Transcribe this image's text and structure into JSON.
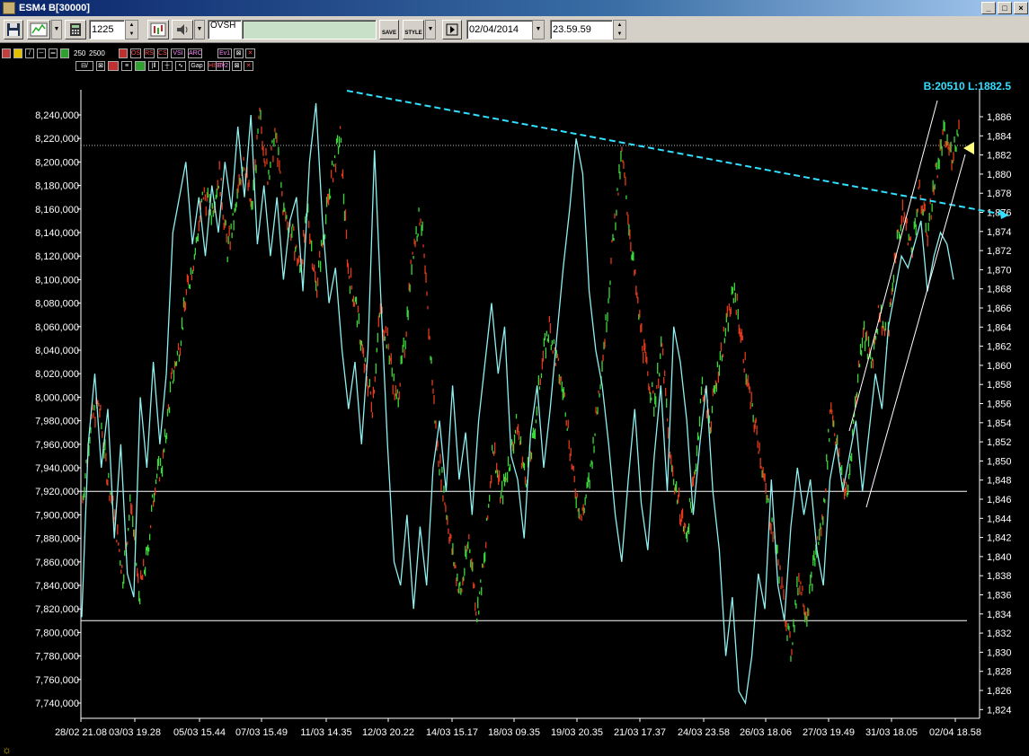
{
  "window": {
    "title": "ESM4 B[30000]",
    "controls": [
      "_",
      "□",
      "×"
    ]
  },
  "toolbar": {
    "interval_value": "1225",
    "symbol_value": "OVSH",
    "save_label": "SAVE",
    "style_label": "STYLE",
    "date_value": "02/04/2014",
    "time_value": "23.59.59"
  },
  "chart_toolbar": {
    "val_250": "250",
    "val_2500": "2500",
    "icons": [
      "OS",
      "RS",
      "CS",
      "VSI",
      "ARC",
      "Ev1",
      "Ev2",
      "HIST",
      "Gap"
    ]
  },
  "chart_header": "B:20510 L:1882.5",
  "colors": {
    "cyan_line": "#8ff0f0",
    "bull": "#3ad83a",
    "bear": "#e03a1a",
    "trend": "#33e0ff",
    "marker": "#ffff80"
  },
  "chart_data": {
    "type": "line",
    "left_axis": {
      "ticks": [
        "8,240,000",
        "8,220,000",
        "8,200,000",
        "8,180,000",
        "8,160,000",
        "8,140,000",
        "8,120,000",
        "8,100,000",
        "8,080,000",
        "8,060,000",
        "8,040,000",
        "8,020,000",
        "8,000,000",
        "7,980,000",
        "7,960,000",
        "7,940,000",
        "7,920,000",
        "7,900,000",
        "7,880,000",
        "7,860,000",
        "7,840,000",
        "7,820,000",
        "7,800,000",
        "7,780,000",
        "7,760,000",
        "7,740,000"
      ],
      "range": [
        7730000,
        8250000
      ]
    },
    "right_axis": {
      "ticks": [
        "1,886",
        "1,884",
        "1,882",
        "1,880",
        "1,878",
        "1,876",
        "1,874",
        "1,872",
        "1,870",
        "1,868",
        "1,866",
        "1,864",
        "1,862",
        "1,860",
        "1,858",
        "1,856",
        "1,854",
        "1,852",
        "1,850",
        "1,848",
        "1,846",
        "1,844",
        "1,842",
        "1,840",
        "1,838",
        "1,836",
        "1,834",
        "1,832",
        "1,830",
        "1,828",
        "1,826",
        "1,824"
      ],
      "range": [
        1823,
        1887
      ]
    },
    "x_ticks": [
      "28/02 21.08",
      "03/03 19.28",
      "05/03 15.44",
      "07/03 15.49",
      "11/03 14.35",
      "12/03 20.22",
      "14/03 15.17",
      "18/03 09.35",
      "19/03 20.35",
      "21/03 17.37",
      "24/03 23.58",
      "26/03 18.06",
      "27/03 19.49",
      "31/03 18.05",
      "02/04 18.58"
    ],
    "horizontal_lines_left": [
      7920000,
      7810000
    ],
    "horizontal_lines_right": [
      1883
    ],
    "breadth_series": [
      7813000,
      7960000,
      8020000,
      7940000,
      7990000,
      7880000,
      7960000,
      7850000,
      7830000,
      8000000,
      7940000,
      8030000,
      7960000,
      8020000,
      8140000,
      8170000,
      8200000,
      8130000,
      8170000,
      8120000,
      8180000,
      8140000,
      8200000,
      8160000,
      8230000,
      8170000,
      8240000,
      8130000,
      8180000,
      8120000,
      8170000,
      8100000,
      8150000,
      8170000,
      8090000,
      8200000,
      8250000,
      8150000,
      8080000,
      8110000,
      8040000,
      7990000,
      8030000,
      7960000,
      8040000,
      8210000,
      8080000,
      7960000,
      7860000,
      7840000,
      7900000,
      7820000,
      7890000,
      7840000,
      7940000,
      7980000,
      7920000,
      8010000,
      7930000,
      7970000,
      7900000,
      7980000,
      8030000,
      8080000,
      8020000,
      8060000,
      7950000,
      7930000,
      7880000,
      7970000,
      8010000,
      7940000,
      7990000,
      8050000,
      8110000,
      8160000,
      8220000,
      8190000,
      8090000,
      8040000,
      8010000,
      7960000,
      7900000,
      7860000,
      7930000,
      7990000,
      7910000,
      7870000,
      7950000,
      8010000,
      7920000,
      8060000,
      8030000,
      7980000,
      7900000,
      7960000,
      8010000,
      7920000,
      7870000,
      7780000,
      7830000,
      7750000,
      7740000,
      7780000,
      7850000,
      7820000,
      7930000,
      7840000,
      7810000,
      7890000,
      7940000,
      7900000,
      7930000,
      7870000,
      7840000,
      7930000,
      7960000,
      7920000,
      7950000,
      7980000,
      7920000,
      7970000,
      8020000,
      7990000,
      8060000,
      8090000,
      8120000,
      8110000,
      8130000,
      8150000,
      8090000,
      8120000,
      8140000,
      8130000,
      8100000
    ],
    "price_series": [
      1846,
      1854,
      1856,
      1849,
      1844,
      1838,
      1846,
      1836,
      1840,
      1848,
      1850,
      1858,
      1862,
      1868,
      1872,
      1878,
      1876,
      1880,
      1872,
      1876,
      1882,
      1876,
      1886,
      1880,
      1884,
      1876,
      1874,
      1870,
      1876,
      1868,
      1874,
      1880,
      1884,
      1870,
      1866,
      1860,
      1856,
      1866,
      1862,
      1856,
      1862,
      1872,
      1876,
      1864,
      1852,
      1846,
      1840,
      1836,
      1842,
      1834,
      1840,
      1852,
      1846,
      1850,
      1854,
      1848,
      1852,
      1860,
      1864,
      1860,
      1856,
      1848,
      1844,
      1848,
      1856,
      1864,
      1874,
      1882,
      1874,
      1866,
      1860,
      1856,
      1862,
      1850,
      1846,
      1842,
      1848,
      1858,
      1854,
      1860,
      1864,
      1868,
      1862,
      1856,
      1852,
      1846,
      1842,
      1836,
      1830,
      1838,
      1834,
      1840,
      1844,
      1856,
      1850,
      1846,
      1856,
      1864,
      1860,
      1866,
      1862,
      1872,
      1876,
      1872,
      1878,
      1874,
      1880,
      1884,
      1882,
      1885
    ]
  }
}
